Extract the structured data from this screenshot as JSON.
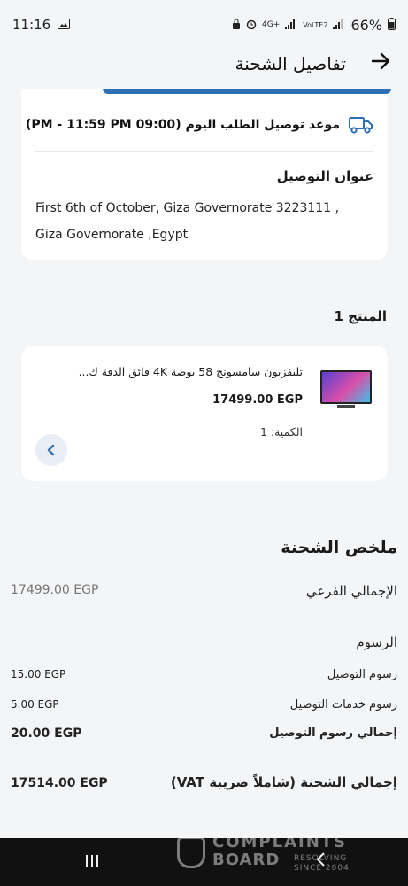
{
  "status_bar": {
    "time": "11:16",
    "network": "4G+",
    "signal_label": "VoLTE2",
    "battery": "66%"
  },
  "header": {
    "title": "تفاصيل الشحنة"
  },
  "delivery": {
    "slot_text": "موعد توصيل الطلب اليوم (09:00 PM - 11:59 PM)",
    "address_title": "عنوان التوصيل",
    "address_text": "First 6th of October, Giza Governorate 3223111 , Giza Governorate ,Egypt"
  },
  "products": {
    "section_title": "المنتج 1",
    "items": [
      {
        "name": "تليفزيون سامسونج 58 بوصة 4K فائق الدقة ك...",
        "price": "17499.00 EGP",
        "quantity": "الكمية: 1"
      }
    ]
  },
  "summary": {
    "title": "ملخص الشحنة",
    "subtotal_label": "الإجمالي الفرعي",
    "subtotal_value": "17499.00 EGP",
    "fees_label": "الرسوم",
    "delivery_fee_label": "رسوم التوصيل",
    "delivery_fee_value": "15.00 EGP",
    "delivery_service_fee_label": "رسوم خدمات التوصيل",
    "delivery_service_fee_value": "5.00 EGP",
    "total_delivery_fees_label": "إجمالي رسوم التوصيل",
    "total_delivery_fees_value": "20.00 EGP",
    "grand_total_label": "إجمالي الشحنة (شاملاً ضريبة VAT)",
    "grand_total_value": "17514.00 EGP"
  },
  "watermark": {
    "line1": "COMPLAINTS",
    "line2": "BOARD",
    "line3": "RESOLVING",
    "line4": "SINCE 2004"
  },
  "colors": {
    "accent": "#2d6fb5",
    "background": "#f4f5f7",
    "card": "#ffffff"
  }
}
